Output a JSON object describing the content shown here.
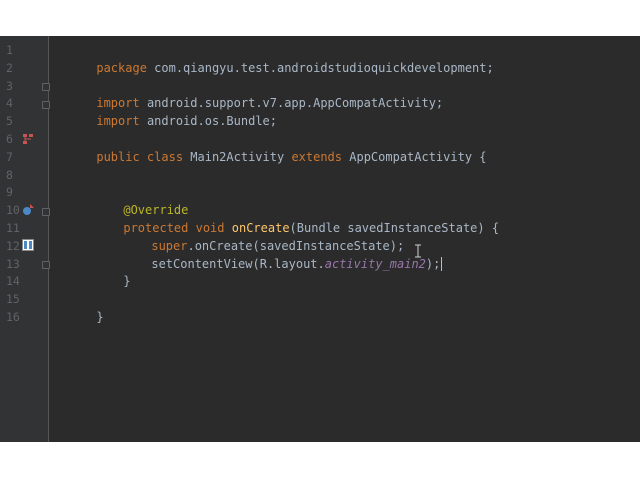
{
  "editor": {
    "line_numbers": [
      "1",
      "2",
      "3",
      "4",
      "5",
      "6",
      "7",
      "8",
      "9",
      "10",
      "11",
      "12",
      "13",
      "14",
      "15",
      "16"
    ],
    "code": {
      "l1_kw": "package",
      "l1_rest": " com.qiangyu.test.androidstudioquickdevelopment;",
      "l3_kw": "import",
      "l3_rest": " android.support.v7.app.AppCompatActivity;",
      "l4_kw": "import",
      "l4_rest": " android.os.Bundle;",
      "l6_kw1": "public class",
      "l6_name": " Main2Activity ",
      "l6_kw2": "extends",
      "l6_rest": " AppCompatActivity {",
      "l9_ann": "@Override",
      "l10_kw": "protected void",
      "l10_fn": " onCreate",
      "l10_rest": "(Bundle savedInstanceState) {",
      "l11_kw": "super",
      "l11_rest": ".onCreate(savedInstanceState);",
      "l12_pre": "setContentView(R.layout.",
      "l12_ital": "activity_main2",
      "l12_post": ");",
      "l13": "}",
      "l15": "}"
    },
    "gutter_icons": {
      "line6": "hierarchy-icon",
      "line10": "override-icon",
      "line12": "layout-preview-icon"
    }
  },
  "colors": {
    "background": "#2b2b2b",
    "gutter": "#313335",
    "keyword": "#cc7832",
    "annotation": "#bbb529",
    "function": "#ffc66d",
    "field": "#9876aa",
    "text": "#a9b7c6"
  }
}
